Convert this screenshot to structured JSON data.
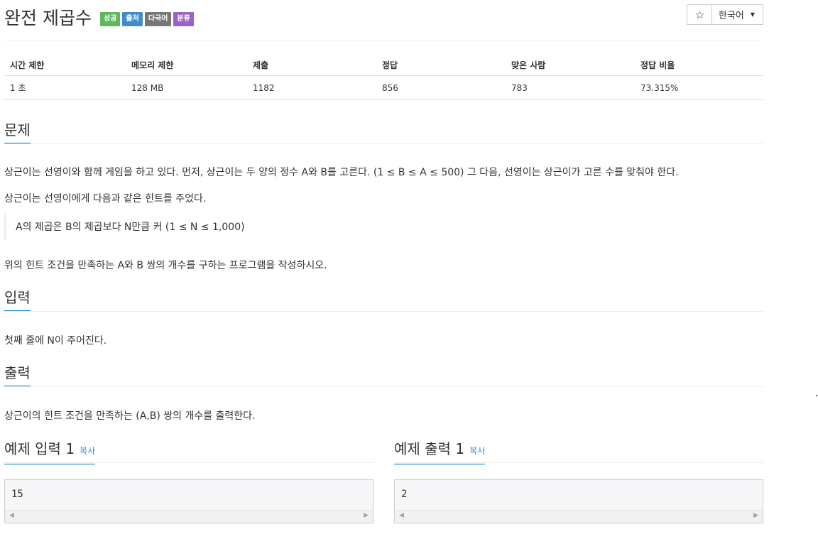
{
  "problem": {
    "title": "완전 제곱수",
    "badges": [
      {
        "label": "성공",
        "color": "#5cb85c"
      },
      {
        "label": "출처",
        "color": "#428bca"
      },
      {
        "label": "다국어",
        "color": "#777777"
      },
      {
        "label": "분류",
        "color": "#9e62c5"
      }
    ]
  },
  "toolbar": {
    "star_icon": "☆",
    "language": "한국어",
    "caret": "▼"
  },
  "info_table": {
    "headers": [
      "시간 제한",
      "메모리 제한",
      "제출",
      "정답",
      "맞은 사람",
      "정답 비율"
    ],
    "values": [
      "1 초",
      "128 MB",
      "1182",
      "856",
      "783",
      "73.315%"
    ]
  },
  "sections": {
    "description": {
      "heading": "문제",
      "p1": "상근이는 선영이와 함께 게임을 하고 있다. 먼저, 상근이는 두 양의 정수 A와 B를 고른다. (1 ≤ B ≤ A ≤ 500) 그 다음, 선영이는 상근이가 고른 수를 맞춰야 한다.",
      "p2": "상근이는 선영이에게 다음과 같은 힌트를 주었다.",
      "quote": "A의 제곱은 B의 제곱보다 N만큼 커 (1 ≤ N ≤ 1,000)",
      "p3": "위의 힌트 조건을 만족하는 A와 B 쌍의 개수를 구하는 프로그램을 작성하시오."
    },
    "input": {
      "heading": "입력",
      "text": "첫째 줄에 N이 주어진다."
    },
    "output": {
      "heading": "출력",
      "text": "상근이의 힌트 조건을 만족하는 (A,B) 쌍의 개수를 출력한다."
    }
  },
  "examples": {
    "input": {
      "heading": "예제 입력 1",
      "copy": "복사",
      "value": "15"
    },
    "output": {
      "heading": "예제 출력 1",
      "copy": "복사",
      "value": "2"
    },
    "scroll_left": "◀",
    "scroll_right": "▶"
  }
}
